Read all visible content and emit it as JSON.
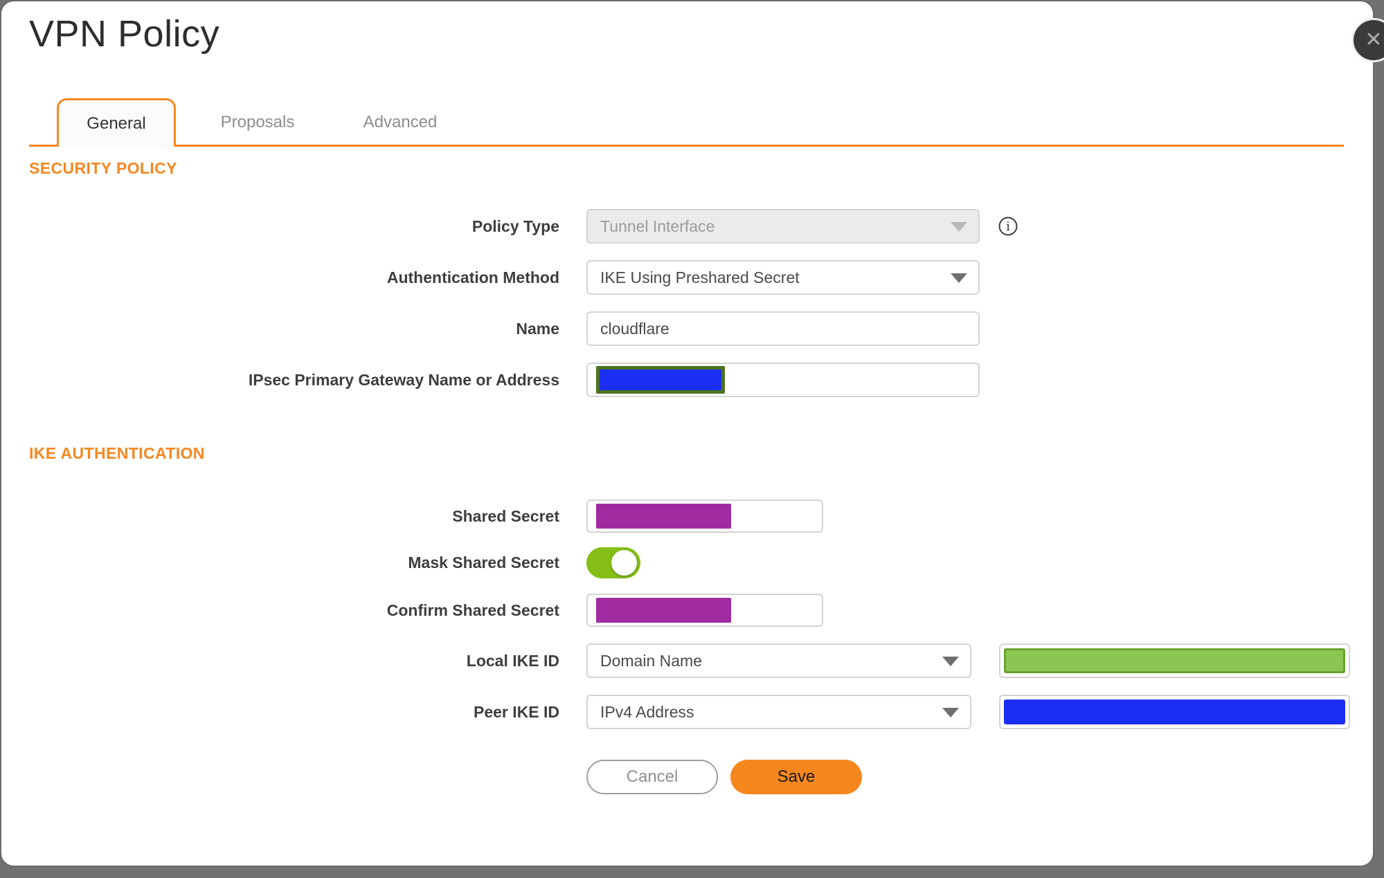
{
  "window": {
    "title": "VPN Policy"
  },
  "icons": {
    "close": "✕",
    "dropdown": "▼",
    "info": "i"
  },
  "tabs": [
    {
      "label": "General",
      "active": true
    },
    {
      "label": "Proposals",
      "active": false
    },
    {
      "label": "Advanced",
      "active": false
    }
  ],
  "sections": [
    {
      "title": "SECURITY POLICY"
    },
    {
      "title": "IKE AUTHENTICATION"
    }
  ],
  "fields": {
    "policy_type": {
      "label": "Policy Type",
      "value": "Tunnel Interface",
      "disabled": true
    },
    "authentication_method": {
      "label": "Authentication Method",
      "value": "IKE Using Preshared Secret"
    },
    "name": {
      "label": "Name",
      "value": "cloudflare"
    },
    "ipsec_gateway": {
      "label": "IPsec Primary Gateway Name or Address",
      "value": "",
      "redacted": true
    },
    "shared_secret": {
      "label": "Shared Secret",
      "value": "",
      "redacted": true
    },
    "mask_shared_secret": {
      "label": "Mask Shared Secret",
      "on": true
    },
    "confirm_shared_secret": {
      "label": "Confirm Shared Secret",
      "value": "",
      "redacted": true
    },
    "local_ike_id": {
      "label": "Local IKE ID",
      "type_value": "Domain Name",
      "id_redacted": true
    },
    "peer_ike_id": {
      "label": "Peer IKE ID",
      "type_value": "IPv4 Address",
      "id_redacted": true
    }
  },
  "buttons": {
    "cancel": "Cancel",
    "save": "Save"
  },
  "colors": {
    "accent_orange": "#F6871F",
    "toggle_green": "#85BE17",
    "redaction_purple": "#A02BA0",
    "redaction_blue": "#1B2FF2",
    "redaction_green_fill": "#8CC652",
    "redaction_green_border": "#68A22D",
    "redaction_olive_border": "#4C731F",
    "close_button_bg": "#3B3B3B"
  }
}
